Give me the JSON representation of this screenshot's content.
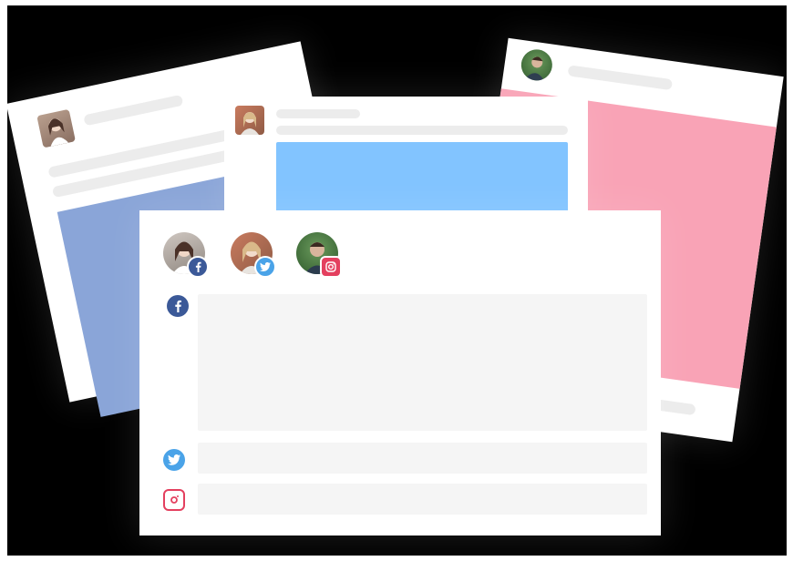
{
  "colors": {
    "background": "#000000",
    "card": "#ffffff",
    "placeholder_bar": "#ececec",
    "field": "#f5f5f5",
    "blue_panel": "#8cb3f0",
    "sky_panel": "#82c4ff",
    "pink_panel": "#f9a3b6",
    "facebook": "#3b5998",
    "twitter": "#4aa3e8",
    "instagram": "#e4405f"
  },
  "cards": [
    {
      "name": "back-left-card",
      "media_color": "#8aa5d8",
      "avatar": "woman-brunette-avatar"
    },
    {
      "name": "back-middle-card",
      "media_color": "#82c4ff",
      "avatar": "woman-blonde-avatar"
    },
    {
      "name": "back-right-card",
      "media_color": "#f9a3b6",
      "avatar": "man-green-avatar"
    }
  ],
  "front_card": {
    "accounts": [
      {
        "avatar": "woman-brunette-avatar",
        "network": "facebook-icon"
      },
      {
        "avatar": "woman-blonde-avatar",
        "network": "twitter-icon"
      },
      {
        "avatar": "man-green-avatar",
        "network": "instagram-icon"
      }
    ],
    "composer_rows": [
      {
        "network": "facebook-icon"
      },
      {
        "network": "twitter-icon"
      },
      {
        "network": "instagram-icon"
      }
    ]
  }
}
